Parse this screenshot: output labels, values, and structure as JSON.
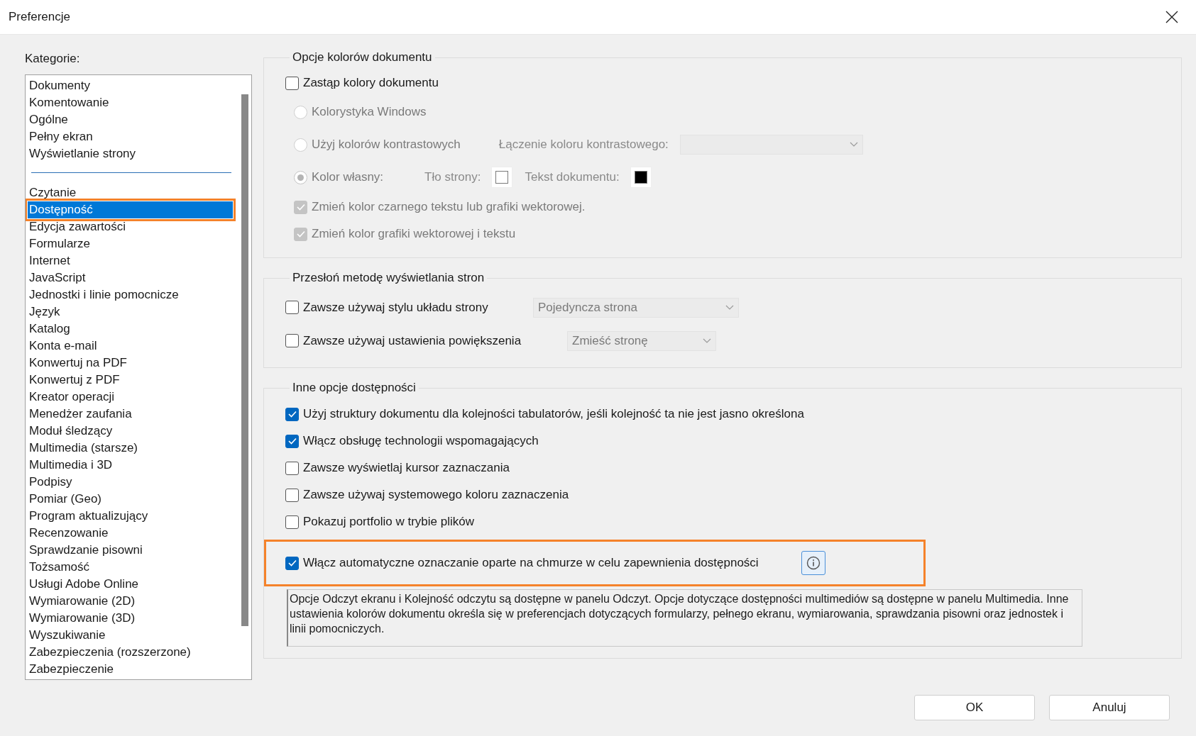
{
  "window": {
    "title": "Preferencje"
  },
  "categories": {
    "label": "Kategorie:",
    "groups": [
      {
        "items": [
          {
            "label": "Dokumenty",
            "selected": false,
            "highlighted": false
          },
          {
            "label": "Komentowanie",
            "selected": false,
            "highlighted": false
          },
          {
            "label": "Ogólne",
            "selected": false,
            "highlighted": false
          },
          {
            "label": "Pełny ekran",
            "selected": false,
            "highlighted": false
          },
          {
            "label": "Wyświetlanie strony",
            "selected": false,
            "highlighted": false
          }
        ]
      },
      {
        "items": [
          {
            "label": "Czytanie",
            "selected": false,
            "highlighted": false
          },
          {
            "label": "Dostępność",
            "selected": true,
            "highlighted": true
          },
          {
            "label": "Edycja zawartości",
            "selected": false,
            "highlighted": false
          },
          {
            "label": "Formularze",
            "selected": false,
            "highlighted": false
          },
          {
            "label": "Internet",
            "selected": false,
            "highlighted": false
          },
          {
            "label": "JavaScript",
            "selected": false,
            "highlighted": false
          },
          {
            "label": "Jednostki i linie pomocnicze",
            "selected": false,
            "highlighted": false
          },
          {
            "label": "Język",
            "selected": false,
            "highlighted": false
          },
          {
            "label": "Katalog",
            "selected": false,
            "highlighted": false
          },
          {
            "label": "Konta e-mail",
            "selected": false,
            "highlighted": false
          },
          {
            "label": "Konwertuj na PDF",
            "selected": false,
            "highlighted": false
          },
          {
            "label": "Konwertuj z PDF",
            "selected": false,
            "highlighted": false
          },
          {
            "label": "Kreator operacji",
            "selected": false,
            "highlighted": false
          },
          {
            "label": "Menedżer zaufania",
            "selected": false,
            "highlighted": false
          },
          {
            "label": "Moduł śledzący",
            "selected": false,
            "highlighted": false
          },
          {
            "label": "Multimedia (starsze)",
            "selected": false,
            "highlighted": false
          },
          {
            "label": "Multimedia i 3D",
            "selected": false,
            "highlighted": false
          },
          {
            "label": "Podpisy",
            "selected": false,
            "highlighted": false
          },
          {
            "label": "Pomiar (Geo)",
            "selected": false,
            "highlighted": false
          },
          {
            "label": "Program aktualizujący",
            "selected": false,
            "highlighted": false
          },
          {
            "label": "Recenzowanie",
            "selected": false,
            "highlighted": false
          },
          {
            "label": "Sprawdzanie pisowni",
            "selected": false,
            "highlighted": false
          },
          {
            "label": "Tożsamość",
            "selected": false,
            "highlighted": false
          },
          {
            "label": "Usługi Adobe Online",
            "selected": false,
            "highlighted": false
          },
          {
            "label": "Wymiarowanie (2D)",
            "selected": false,
            "highlighted": false
          },
          {
            "label": "Wymiarowanie (3D)",
            "selected": false,
            "highlighted": false
          },
          {
            "label": "Wyszukiwanie",
            "selected": false,
            "highlighted": false
          },
          {
            "label": "Zabezpieczenia (rozszerzone)",
            "selected": false,
            "highlighted": false
          },
          {
            "label": "Zabezpieczenie",
            "selected": false,
            "highlighted": false
          }
        ]
      }
    ]
  },
  "document_colors": {
    "title": "Opcje kolorów dokumentu",
    "disabled": true,
    "replace": {
      "label": "Zastąp kolory dokumentu",
      "checked": false
    },
    "modes": [
      {
        "label": "Kolorystyka Windows",
        "selected": false
      },
      {
        "label": "Użyj kolorów kontrastowych",
        "selected": false,
        "field_label": "Łączenie koloru kontrastowego:"
      },
      {
        "label": "Kolor własny:",
        "selected": true,
        "swatches": [
          {
            "label": "Tło strony:",
            "color": "#ffffff"
          },
          {
            "label": "Tekst dokumentu:",
            "color": "#000000"
          }
        ]
      }
    ],
    "changes": [
      {
        "label": "Zmień kolor czarnego tekstu lub grafiki wektorowej.",
        "checked": true
      },
      {
        "label": "Zmień kolor grafiki wektorowej i tekstu",
        "checked": true
      }
    ]
  },
  "page_display": {
    "title": "Przesłoń metodę wyświetlania stron",
    "rows": [
      {
        "label": "Zawsze używaj stylu układu strony",
        "checked": false,
        "value": "Pojedyncza strona",
        "disabled": true
      },
      {
        "label": "Zawsze używaj ustawienia powiększenia",
        "checked": false,
        "value": "Zmieść stronę",
        "disabled": true
      }
    ]
  },
  "other": {
    "title": "Inne opcje dostępności",
    "options": [
      {
        "label": "Użyj struktury dokumentu dla kolejności tabulatorów, jeśli kolejność ta nie jest jasno określona",
        "checked": true,
        "highlighted": false,
        "info": false
      },
      {
        "label": "Włącz obsługę technologii wspomagających",
        "checked": true,
        "highlighted": false,
        "info": false
      },
      {
        "label": "Zawsze wyświetlaj kursor zaznaczania",
        "checked": false,
        "highlighted": false,
        "info": false
      },
      {
        "label": "Zawsze używaj systemowego koloru zaznaczenia",
        "checked": false,
        "highlighted": false,
        "info": false
      },
      {
        "label": "Pokazuj portfolio w trybie plików",
        "checked": false,
        "highlighted": false,
        "info": false
      },
      {
        "label": "Włącz automatyczne oznaczanie oparte na chmurze w celu zapewnienia dostępności",
        "checked": true,
        "highlighted": true,
        "info": true
      }
    ],
    "note": "Opcje Odczyt ekranu i Kolejność odczytu są dostępne w panelu Odczyt. Opcje dotyczące dostępności multimediów są dostępne w panelu Multimedia. Inne ustawienia kolorów dokumentu określa się w preferencjach dotyczących formularzy, pełnego ekranu, wymiarowania, sprawdzania pisowni oraz jednostek i linii pomocniczych."
  },
  "buttons": [
    {
      "label": "OK"
    },
    {
      "label": "Anuluj"
    }
  ]
}
